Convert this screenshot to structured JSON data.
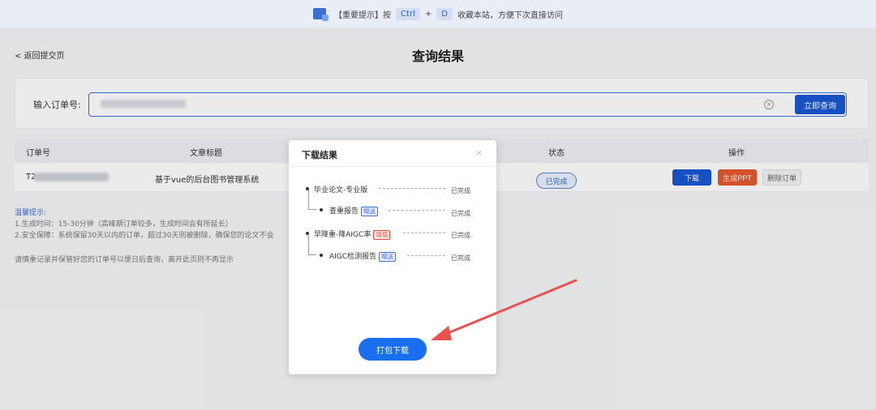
{
  "banner": {
    "prefix": "【重要提示】按",
    "key1": "Ctrl",
    "plus": "+",
    "key2": "D",
    "suffix": "收藏本站，方便下次直接访问"
  },
  "header": {
    "back_label": "< 返回提交页",
    "title": "查询结果"
  },
  "search": {
    "label": "输入订单号:",
    "button": "立即查询"
  },
  "table": {
    "columns": [
      "订单号",
      "文章标题",
      "状态",
      "操作"
    ],
    "rows": [
      {
        "order_prefix": "T2",
        "title": "基于vue的后台图书管理系统",
        "status": "已完成",
        "actions": [
          "下载",
          "生成PPT",
          "删除订单"
        ]
      }
    ]
  },
  "tips": {
    "title": "温馨提示:",
    "lines": [
      "1.生成时间：15-30分钟（高峰期订单较多，生成时间会有所延长）",
      "2.安全保障：系统保留30天以内的订单，超过30天则被删除，确保您的论文不会"
    ],
    "note": "请慎重记录并保管好您的订单号以便日后查询，离开此页则不再显示"
  },
  "modal": {
    "title": "下载结果",
    "close": "×",
    "items": [
      {
        "label": "毕业论文-专业版",
        "tag": "",
        "status": "已完成"
      },
      {
        "label": "查重报告",
        "tag": "赠送",
        "status": "已完成"
      },
      {
        "label": "早降重-降AIGC率",
        "tag": "增值",
        "status": "已完成"
      },
      {
        "label": "AIGC检测报告",
        "tag": "赠送",
        "status": "已完成"
      }
    ],
    "pack_button": "打包下载"
  },
  "colors": {
    "primary": "#1957d2",
    "ppt": "#e4572e",
    "arrow": "#e8534f"
  }
}
